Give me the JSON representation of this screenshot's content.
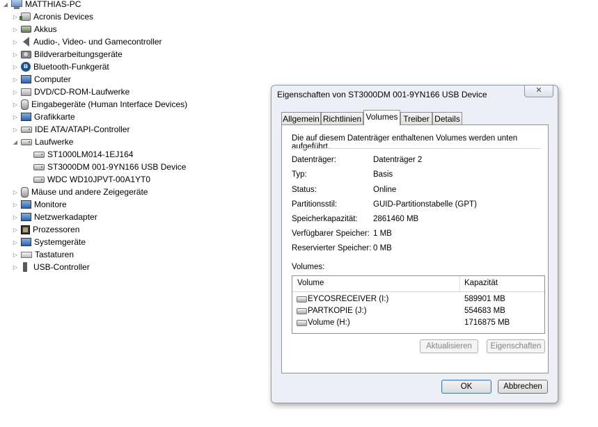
{
  "tree": {
    "root": "MATTHIAS-PC",
    "items": [
      {
        "label": "Acronis Devices",
        "icon": "device-icon"
      },
      {
        "label": "Akkus",
        "icon": "battery-icon"
      },
      {
        "label": "Audio-, Video- und Gamecontroller",
        "icon": "speaker-icon"
      },
      {
        "label": "Bildverarbeitungsgeräte",
        "icon": "camera-icon"
      },
      {
        "label": "Bluetooth-Funkgerät",
        "icon": "bluetooth-icon"
      },
      {
        "label": "Computer",
        "icon": "computer-icon"
      },
      {
        "label": "DVD/CD-ROM-Laufwerke",
        "icon": "dvd-drive-icon"
      },
      {
        "label": "Eingabegeräte (Human Interface Devices)",
        "icon": "hid-icon"
      },
      {
        "label": "Grafikkarte",
        "icon": "graphics-card-icon"
      },
      {
        "label": "IDE ATA/ATAPI-Controller",
        "icon": "ide-controller-icon"
      },
      {
        "label": "Laufwerke",
        "icon": "disk-drive-icon"
      },
      {
        "label": "ST1000LM014-1EJ164",
        "icon": "disk-drive-icon"
      },
      {
        "label": "ST3000DM 001-9YN166 USB Device",
        "icon": "disk-drive-icon"
      },
      {
        "label": "WDC WD10JPVT-00A1YT0",
        "icon": "disk-drive-icon"
      },
      {
        "label": "Mäuse und andere Zeigegeräte",
        "icon": "mouse-icon"
      },
      {
        "label": "Monitore",
        "icon": "monitor-icon"
      },
      {
        "label": "Netzwerkadapter",
        "icon": "network-adapter-icon"
      },
      {
        "label": "Prozessoren",
        "icon": "processor-icon"
      },
      {
        "label": "Systemgeräte",
        "icon": "system-device-icon"
      },
      {
        "label": "Tastaturen",
        "icon": "keyboard-icon"
      },
      {
        "label": "USB-Controller",
        "icon": "usb-icon"
      }
    ]
  },
  "dialog": {
    "title": "Eigenschaften von ST3000DM 001-9YN166 USB Device",
    "close_glyph": "✕",
    "tabs": [
      "Allgemein",
      "Richtlinien",
      "Volumes",
      "Treiber",
      "Details"
    ],
    "active_tab": "Volumes",
    "intro": "Die auf diesem Datenträger enthaltenen Volumes werden unten aufgeführt.",
    "properties": [
      {
        "key": "Datenträger:",
        "value": "Datenträger 2"
      },
      {
        "key": "Typ:",
        "value": "Basis"
      },
      {
        "key": "Status:",
        "value": "Online"
      },
      {
        "key": "Partitionsstil:",
        "value": "GUID-Partitionstabelle (GPT)"
      },
      {
        "key": "Speicherkapazität:",
        "value": "2861460 MB"
      },
      {
        "key": "Verfügbarer Speicher:",
        "value": "1 MB"
      },
      {
        "key": "Reservierter Speicher:",
        "value": "0 MB"
      }
    ],
    "volumes_label": "Volumes:",
    "volumes_columns": [
      "Volume",
      "Kapazität"
    ],
    "volumes": [
      {
        "name": "EYCOSRECEIVER (I:)",
        "capacity": "589901 MB"
      },
      {
        "name": "PARTKOPIE (J:)",
        "capacity": "554683 MB"
      },
      {
        "name": "Volume (H:)",
        "capacity": "1716875 MB"
      }
    ],
    "buttons": {
      "refresh": "Aktualisieren",
      "properties": "Eigenschaften",
      "ok": "OK",
      "cancel": "Abbrechen"
    }
  }
}
